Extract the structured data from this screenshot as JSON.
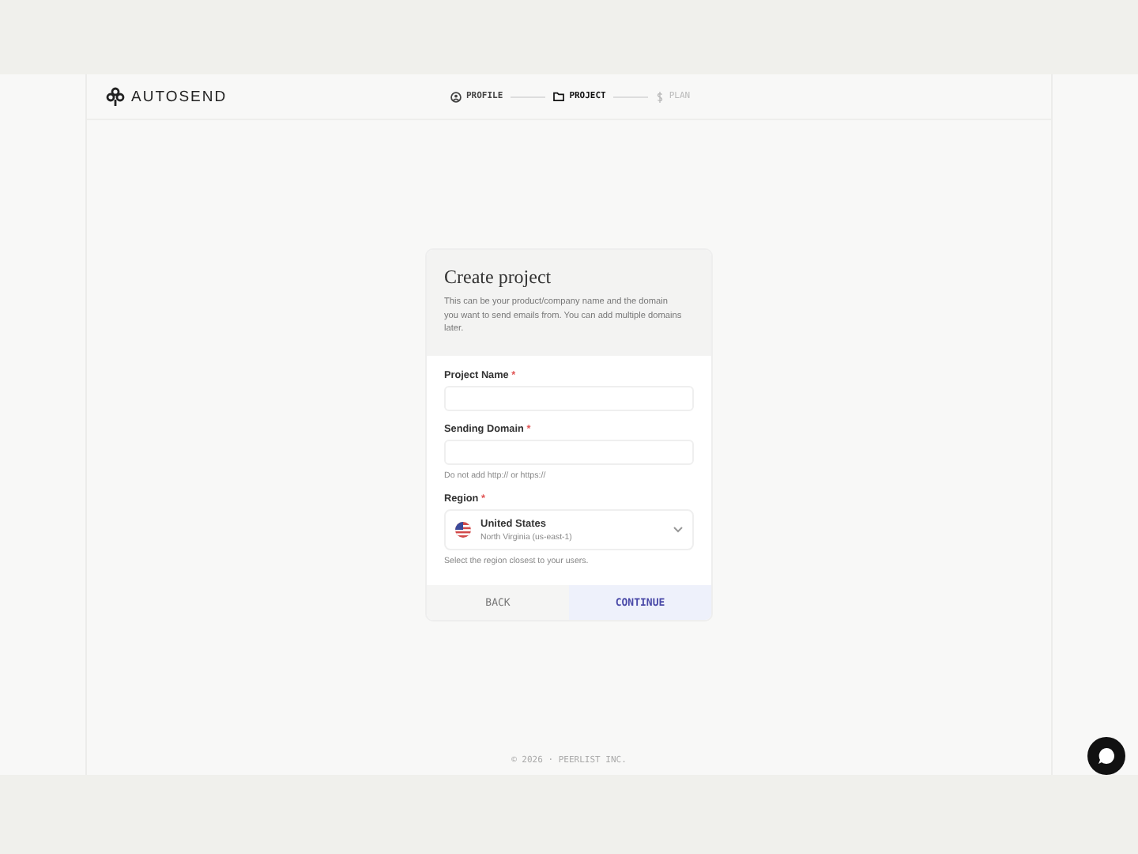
{
  "brand": {
    "name": "AUTOSEND"
  },
  "steps": [
    {
      "label": "PROFILE",
      "selected": false,
      "disabled": false
    },
    {
      "label": "PROJECT",
      "selected": true,
      "disabled": false
    },
    {
      "label": "PLAN",
      "selected": false,
      "disabled": true
    }
  ],
  "card": {
    "title": "Create project",
    "description": "This can be your product/company name and the domain you want to send emails from. You can add multiple domains later.",
    "fields": [
      {
        "kind": "text",
        "label": "Project Name",
        "required_mark": "*"
      },
      {
        "kind": "text",
        "label": "Sending Domain",
        "required_mark": "*",
        "hint": "Do not add http:// or https://"
      },
      {
        "kind": "select",
        "label": "Region",
        "required_mark": "*",
        "value": "United States",
        "subvalue": "North Virginia (us-east-1)",
        "hint": "Select the region closest to your users."
      }
    ],
    "buttons": [
      {
        "label": "BACK",
        "primary": false
      },
      {
        "label": "CONTINUE",
        "primary": true
      }
    ]
  },
  "footer": "© 2026 · PEERLIST INC."
}
